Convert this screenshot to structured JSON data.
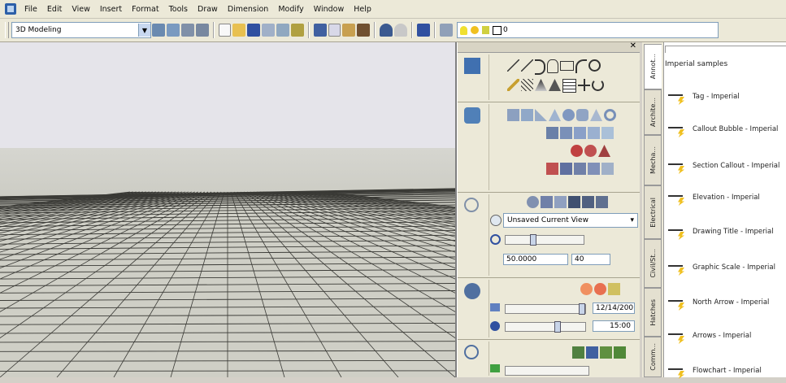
{
  "menu": {
    "items": [
      "File",
      "Edit",
      "View",
      "Insert",
      "Format",
      "Tools",
      "Draw",
      "Dimension",
      "Modify",
      "Window",
      "Help"
    ]
  },
  "toolbar": {
    "workspace": "3D Modeling",
    "layer": "0"
  },
  "dashboard": {
    "view_combo": "Unsaved Current View",
    "zoom_value": "50.0000",
    "lens_value": "40",
    "date_value": "12/14/200",
    "time_value": "15:00"
  },
  "palette": {
    "header": "Imperial samples",
    "tabs": [
      "Annot...",
      "Archite...",
      "Mecha...",
      "Electrical",
      "Civil/St...",
      "Hatches",
      "Comm..."
    ],
    "items": [
      {
        "label": "Tag - Imperial",
        "icon": "tag-icon"
      },
      {
        "label": "Callout Bubble - Imperial",
        "icon": "callout-bubble-icon"
      },
      {
        "label": "Section Callout - Imperial",
        "icon": "section-callout-icon"
      },
      {
        "label": "Elevation - Imperial",
        "icon": "elevation-icon"
      },
      {
        "label": "Drawing Title - Imperial",
        "icon": "drawing-title-icon"
      },
      {
        "label": "Graphic Scale - Imperial",
        "icon": "graphic-scale-icon"
      },
      {
        "label": "North Arrow - Imperial",
        "icon": "north-arrow-icon"
      },
      {
        "label": "Arrows - Imperial",
        "icon": "arrows-icon"
      },
      {
        "label": "Flowchart - Imperial",
        "icon": "flowchart-icon"
      }
    ]
  },
  "colors": {
    "accent": "#2d5fa8",
    "bolt": "#f0c020",
    "sky": "#e5e4ea",
    "ground": "#cfcfc6"
  }
}
